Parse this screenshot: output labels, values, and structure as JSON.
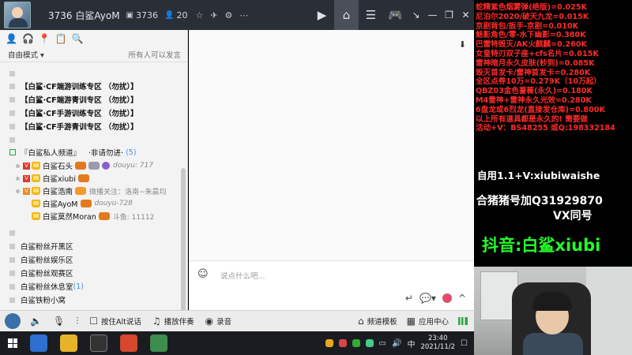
{
  "titlebar": {
    "room": "3736 白鲨AyoM",
    "room_id": "3736",
    "online": "20"
  },
  "left": {
    "mode": "自由模式",
    "mode_right": "所有人可以发言",
    "channels": [
      "【白鲨·CF端游训练专区 （勿扰）】",
      "【白鲨·CF端游青训专区 （勿扰）】",
      "【白鲨·CF手游训练专区 （勿扰）】",
      "【白鲨·CF手游青训专区 （勿扰）】"
    ],
    "private": {
      "name": "『白鲨私人频道』",
      "note": "·非请勿进·",
      "count": "(5)"
    },
    "users": [
      {
        "name": "白鲨石头",
        "extra": "douyu: 717"
      },
      {
        "name": "白鲨xiubi",
        "extra": ""
      },
      {
        "name": "白鲨浩南",
        "extra": "微播关注：洛南~朱晨均"
      },
      {
        "name": "白鲨AyoM",
        "extra": "douyu-728"
      },
      {
        "name": "白鲨莫然Moran",
        "extra": "斗鱼: 11112"
      }
    ],
    "groups": [
      {
        "label": "白鲨粉丝开黑区",
        "count": ""
      },
      {
        "label": "白鲨粉丝娱乐区",
        "count": ""
      },
      {
        "label": "白鲨粉丝观赛区",
        "count": ""
      },
      {
        "label": "白鲨粉丝休息室",
        "count": "(1)"
      },
      {
        "label": "白鲨铁粉小窝",
        "count": ""
      }
    ]
  },
  "chat": {
    "placeholder": "说点什么吧..."
  },
  "bottombar": {
    "ptt": "按住Alt说话",
    "music": "播放伴奏",
    "record": "录音",
    "template": "频道模板",
    "app_center": "应用中心"
  },
  "taskbar": {
    "time": "23:40",
    "date": "2021/11/2",
    "ime": "中"
  },
  "overlay": {
    "prices": [
      "蛇精紫色烟雾弹(绝版)=0.025K",
      "尼泊尔2020/破天九龙=0.015K",
      "京剧背包/扳手-京剧=0.010K",
      "魅影角色/零-水下幽影=0.380K",
      "巴雷特毁灭/AK火麒麟=0.260K",
      "女皇特刃双子座+cfs名片=0.015K",
      "雷神暗月永久皮肤(秒到)=0.085K",
      "毁灭首发卡/雷神首发卡=0.280K",
      "全区点券10万=0.279K（10万起）",
      "QBZ03金色蔷薇(永久)=0.180K",
      "M4雷神+雷神永久光效=0.280K",
      "6盘龙或6烈龙(直接发仓库)=0.800K",
      "以上所有道具都是永久的! 需要做",
      "活动+V：BS48255  或Q:198332184"
    ],
    "wechat": "自用1.1+V:xiubiwaishe",
    "qq": "合猪猪号加Q31929870",
    "vx": "VX同号",
    "douyin": "抖音:白鲨xiubi"
  },
  "colors": {
    "price_text": "#ff2a2a",
    "douyin_text": "#23ff2a",
    "titlebar_bg": "#2a2e37"
  }
}
